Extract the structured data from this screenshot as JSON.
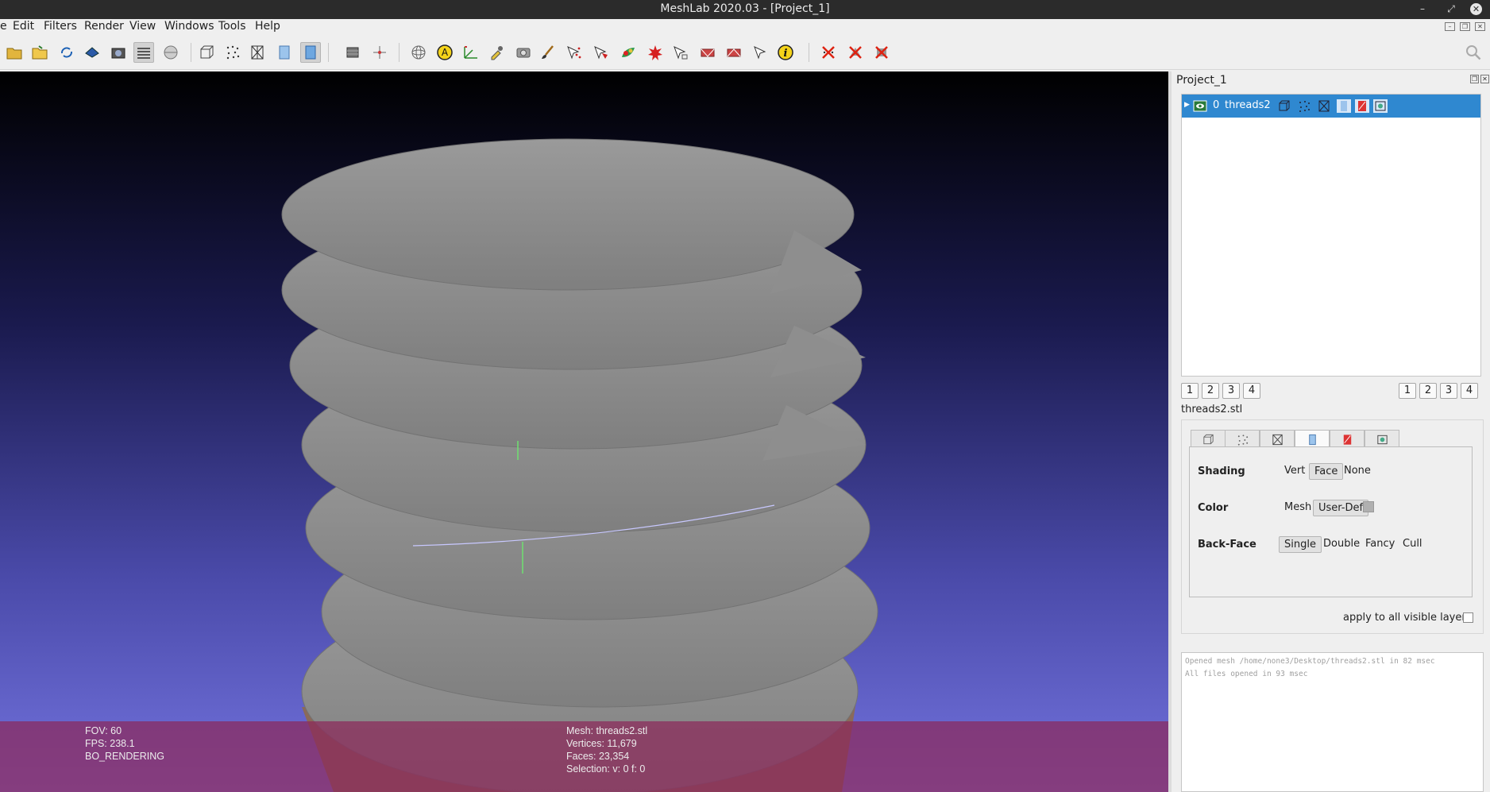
{
  "window": {
    "title": "MeshLab 2020.03 - [Project_1]",
    "controls": [
      "minimize-icon",
      "restore-icon",
      "close-icon"
    ]
  },
  "menubar": {
    "items": [
      "e",
      "Edit",
      "Filters",
      "Render",
      "View",
      "Windows",
      "Tools",
      "Help"
    ]
  },
  "toolbar": {
    "icons": [
      "open-project-icon",
      "open-mesh-icon",
      "reload-icon",
      "export-mesh-icon",
      "snapshot-icon",
      "layers-icon",
      "raster-icon",
      "bbox-icon",
      "points-icon",
      "wireframe-icon",
      "flat-shading-icon",
      "smooth-shading-icon",
      "lighting-icon",
      "axes-icon",
      "trackball-icon",
      "text-annotation-icon",
      "measure-icon",
      "color-picker-icon",
      "camera-icon",
      "paint-brush-icon",
      "select-vertex-icon",
      "select-faces-icon",
      "paint-mesh-icon",
      "georef-icon",
      "align-icon",
      "select-connected-icon",
      "select-region-icon",
      "pick-points-icon",
      "info-icon",
      "delete-vertices-icon",
      "delete-faces-icon",
      "delete-all-icon"
    ]
  },
  "viewport": {
    "info_left": {
      "fov": "FOV: 60",
      "fps": "FPS:   238.1",
      "mode": "BO_RENDERING"
    },
    "info_right": {
      "mesh": "Mesh: threads2.stl",
      "vertices": "Vertices: 11,679",
      "faces": "Faces: 23,354",
      "selection": "Selection: v: 0 f: 0"
    }
  },
  "panel": {
    "title": "Project_1",
    "layer": {
      "index": "0",
      "name": "threads2"
    },
    "view_buttons_left": [
      "1",
      "2",
      "3",
      "4"
    ],
    "view_buttons_right": [
      "1",
      "2",
      "3",
      "4"
    ],
    "file_label": "threads2.stl",
    "properties": {
      "shading_label": "Shading",
      "shading_options": [
        "Vert",
        "Face",
        "None"
      ],
      "shading_selected": "Face",
      "color_label": "Color",
      "color_options": [
        "Mesh",
        "User-Def"
      ],
      "color_selected": "User-Def",
      "backface_label": "Back-Face",
      "backface_options": [
        "Single",
        "Double",
        "Fancy",
        "Cull"
      ],
      "backface_selected": "Single"
    },
    "apply_all_label": "apply to all visible layers",
    "log": [
      "Opened mesh /home/none3/Desktop/threads2.stl in 82 msec",
      "All files opened in 93 msec"
    ]
  },
  "colors": {
    "layer_highlight": "#2f88d0",
    "info_overlay": "#8c285a",
    "mesh_gray": "#8e8e8e"
  }
}
